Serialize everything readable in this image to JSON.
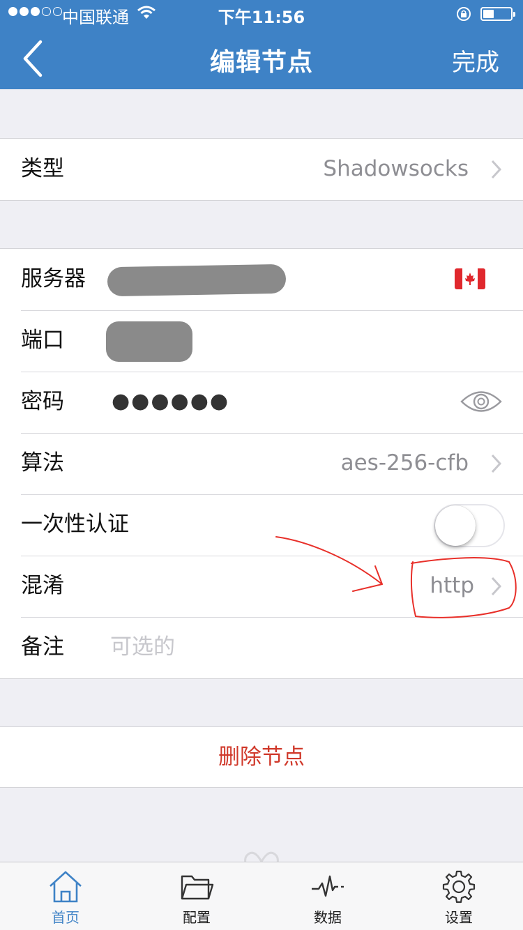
{
  "status_bar": {
    "carrier": "中国联通",
    "time": "下午11:56",
    "signal_bars": 3,
    "signal_total": 5
  },
  "nav": {
    "back_icon": "chevron-left-icon",
    "title": "编辑节点",
    "done_label": "完成"
  },
  "type_row": {
    "label": "类型",
    "value": "Shadowsocks"
  },
  "form": {
    "server_label": "服务器",
    "port_label": "端口",
    "password_label": "密码",
    "password_mask": "●●●●●●",
    "cipher_label": "算法",
    "cipher_value": "aes-256-cfb",
    "ota_label": "一次性认证",
    "ota_enabled": false,
    "obfs_label": "混淆",
    "obfs_value": "http",
    "note_label": "备注",
    "note_placeholder": "可选的"
  },
  "delete_label": "删除节点",
  "tabbar": {
    "tabs": [
      {
        "label": "首页",
        "icon": "home-icon",
        "active": true
      },
      {
        "label": "配置",
        "icon": "folder-icon",
        "active": false
      },
      {
        "label": "数据",
        "icon": "activity-icon",
        "active": false
      },
      {
        "label": "设置",
        "icon": "gear-icon",
        "active": false
      }
    ]
  },
  "colors": {
    "accent": "#3e82c6",
    "destructive": "#d0392b",
    "annotation": "#e8302a",
    "background": "#efeff4"
  }
}
